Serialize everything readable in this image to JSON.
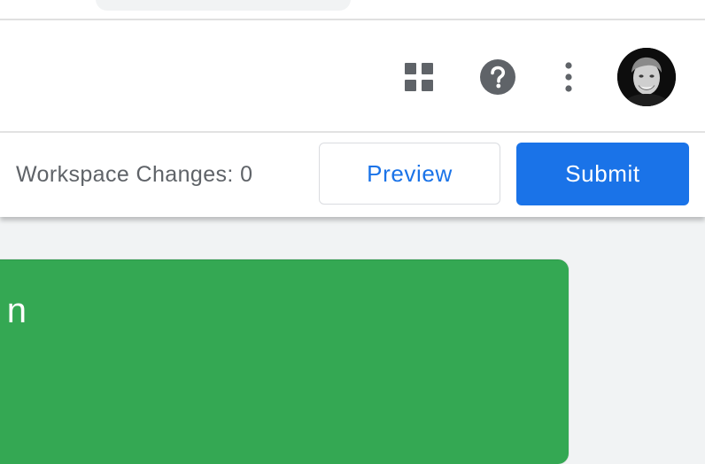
{
  "header": {
    "icons": [
      "apps-grid-icon",
      "help-icon",
      "more-vert-icon"
    ],
    "avatar": "user-avatar"
  },
  "toolbar": {
    "workspace_changes_label": "Workspace Changes: 0",
    "preview_label": "Preview",
    "submit_label": "Submit"
  },
  "card": {
    "partial_text": "n"
  },
  "colors": {
    "accent": "#1a73e8",
    "card_green": "#34a853",
    "icon_gray": "#5f6368"
  }
}
